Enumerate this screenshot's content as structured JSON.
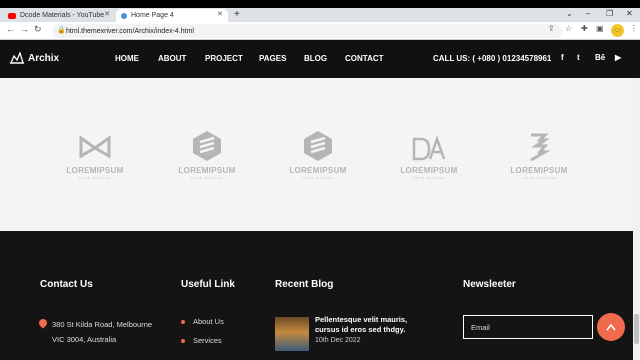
{
  "browser": {
    "tabs": [
      {
        "label": "Dcode Materials - YouTube",
        "favicon_color": "#ff0000"
      },
      {
        "label": "Home Page 4",
        "favicon_color": "#4a90d9"
      }
    ],
    "new_tab": "+",
    "url": "html.themexriver.com/Archix/index-4.html",
    "window_controls": [
      "⌄",
      "–",
      "❐",
      "✕"
    ],
    "avatar_letter": "😊"
  },
  "header": {
    "logo": "Archix",
    "menu": [
      "HOME",
      "ABOUT",
      "PROJECT",
      "PAGES",
      "BLOG",
      "CONTACT"
    ],
    "call": "CALL US: ( +080 ) 01234578961",
    "social": [
      "f",
      "t",
      "Bē",
      "▶"
    ]
  },
  "brands": [
    {
      "name": "LOREMIPSUM",
      "tag": "YOUR SLOGAN"
    },
    {
      "name": "LOREMIPSUM",
      "tag": "YOUR SLOGAN"
    },
    {
      "name": "LOREMIPSUM",
      "tag": "YOUR SLOGAN"
    },
    {
      "name": "LOREMIPSUM",
      "tag": "YOUR SLOGAN"
    },
    {
      "name": "LOREMIPSUM",
      "tag": "YOUR SLOGAN"
    }
  ],
  "footer": {
    "contact_title": "Contact Us",
    "address_line1": "380 St Kilda Road, Melbourne",
    "address_line2": "VIC 3004, Australia",
    "useful_title": "Useful Link",
    "links": [
      "About Us",
      "Services"
    ],
    "blog_title": "Recent Blog",
    "blog_post_title": "Pellentesque velit mauris, cursus id eros sed thdgy.",
    "blog_post_date": "10th Dec 2022",
    "newsletter_title": "Newsleeter",
    "email_placeholder": "Email"
  },
  "colors": {
    "accent": "#f06a4d",
    "header_bg": "#111111",
    "footer_bg": "#141414"
  }
}
